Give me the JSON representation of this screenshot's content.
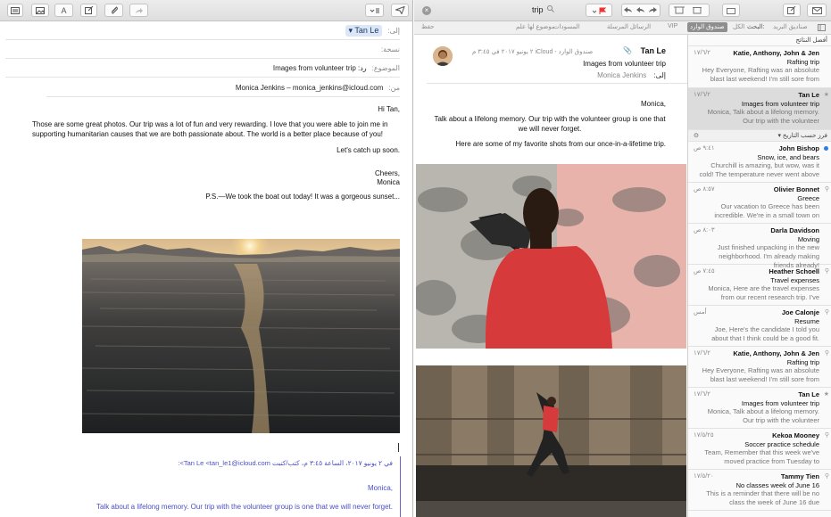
{
  "compose": {
    "toolbar": {
      "send_icon": "paper-plane-icon",
      "header_fields_icon": "header-fields-menu-icon",
      "format_label": "A"
    },
    "to_label": "إلى:",
    "to_recipient": "Tan Le",
    "cc_label": "نسخة:",
    "subject_label": "الموضوع:",
    "subject_value": "رد: Images from volunteer trip",
    "from_label": "من:",
    "from_value": "Monica Jenkins – monica_jenkins@icloud.com",
    "body": {
      "greeting": "Hi Tan,",
      "paragraph": "Those are some great photos. Our trip was a lot of fun and very rewarding. I love that you were able to join me in supporting humanitarian causes that we are both passionate about. The world is a better place because of you!",
      "line2": "Let's catch up soon.",
      "signoff": "Cheers,",
      "signature": "Monica",
      "ps": "P.S.—We took the boat out today! It was a gorgeous sunset..."
    },
    "quote_header": "في ٢ يونيو ٢٠١٧، الساعة ٣:٤٥ م، كتب/كتبت Tan Le <tan_le1@icloud.com>:",
    "quote_greeting": "Monica,",
    "quote_body": "Talk about a lifelong memory. Our trip with the volunteer group is one that we will never forget."
  },
  "viewer": {
    "search_value": "trip",
    "favorites": {
      "mailboxes": "صناديق البريد",
      "search_label": "البحث:",
      "all": "الكل",
      "inbox": "صندوق الوارد",
      "vip": "VIP",
      "sent": "الرسائل المرسلة",
      "drafts": "المسودات",
      "flagged": "موضوع لها علم",
      "save": "حفظ"
    },
    "top_hits_label": "أفضل النتائج",
    "sort_label": "فرز حسب التاريخ",
    "top_hits": [
      {
        "from": "Katie, Anthony, John & Jen",
        "date": "١٧/٦/٢",
        "subject": "Rafting trip",
        "preview": "Hey Everyone, Rafting was an absolute blast last weekend! I'm still sore from"
      },
      {
        "from": "Tan Le",
        "date": "١٧/٦/٢",
        "subject": "Images from volunteer trip",
        "preview": "Monica, Talk about a lifelong memory. Our trip with the volunteer"
      }
    ],
    "messages": [
      {
        "from": "John Bishop",
        "date": "٩:٤١ ص",
        "subject": "Snow, ice, and bears",
        "preview": "Churchill is amazing, but wow, was it cold! The temperature never went above"
      },
      {
        "from": "Olivier Bonnet",
        "date": "٨:٥٧ ص",
        "subject": "Greece",
        "preview": "Our vacation to Greece has been incredible. We're in a small town on"
      },
      {
        "from": "Darla Davidson",
        "date": "٨:٠٣ ص",
        "subject": "Moving",
        "preview": "Just finished unpacking in the new neighborhood. I'm already making friends already!"
      },
      {
        "from": "Heather Schoell",
        "date": "٧:٤٥ ص",
        "subject": "Travel expenses",
        "preview": "Monica, Here are the travel expenses from our recent research trip. I've"
      },
      {
        "from": "Joe Calonje",
        "date": "أمس",
        "subject": "Resume",
        "preview": "Joe, Here's the candidate I told you about that I think could be a good fit."
      },
      {
        "from": "Katie, Anthony, John & Jen",
        "date": "١٧/٦/٢",
        "subject": "Rafting trip",
        "preview": "Hey Everyone, Rafting was an absolute blast last weekend! I'm still sore from"
      },
      {
        "from": "Tan Le",
        "date": "١٧/٦/٢",
        "subject": "Images from volunteer trip",
        "preview": "Monica, Talk about a lifelong memory. Our trip with the volunteer"
      },
      {
        "from": "Kekoa Mooney",
        "date": "١٧/٥/٢٥",
        "subject": "Soccer practice schedule",
        "preview": "Team, Remember that this week we've moved practice from Tuesday to"
      },
      {
        "from": "Tammy Tien",
        "date": "١٧/٥/٢٠",
        "subject": "No classes week of June 16",
        "preview": "This is a reminder that there will be no class the week of June 16 due"
      }
    ],
    "reader": {
      "from": "Tan Le",
      "meta": "صندوق الوارد - iCloud  ٢ يونيو ٢٠١٧ في ٣:٤٥ م",
      "subject": "Images from volunteer trip",
      "to_label": "إلى:",
      "to_value": "Monica Jenkins",
      "greeting": "Monica,",
      "para": "Talk about a lifelong memory. Our trip with the volunteer group is one that we will never forget.",
      "line2": "Here are some of my favorite shots from our once-in-a-lifetime trip."
    }
  }
}
